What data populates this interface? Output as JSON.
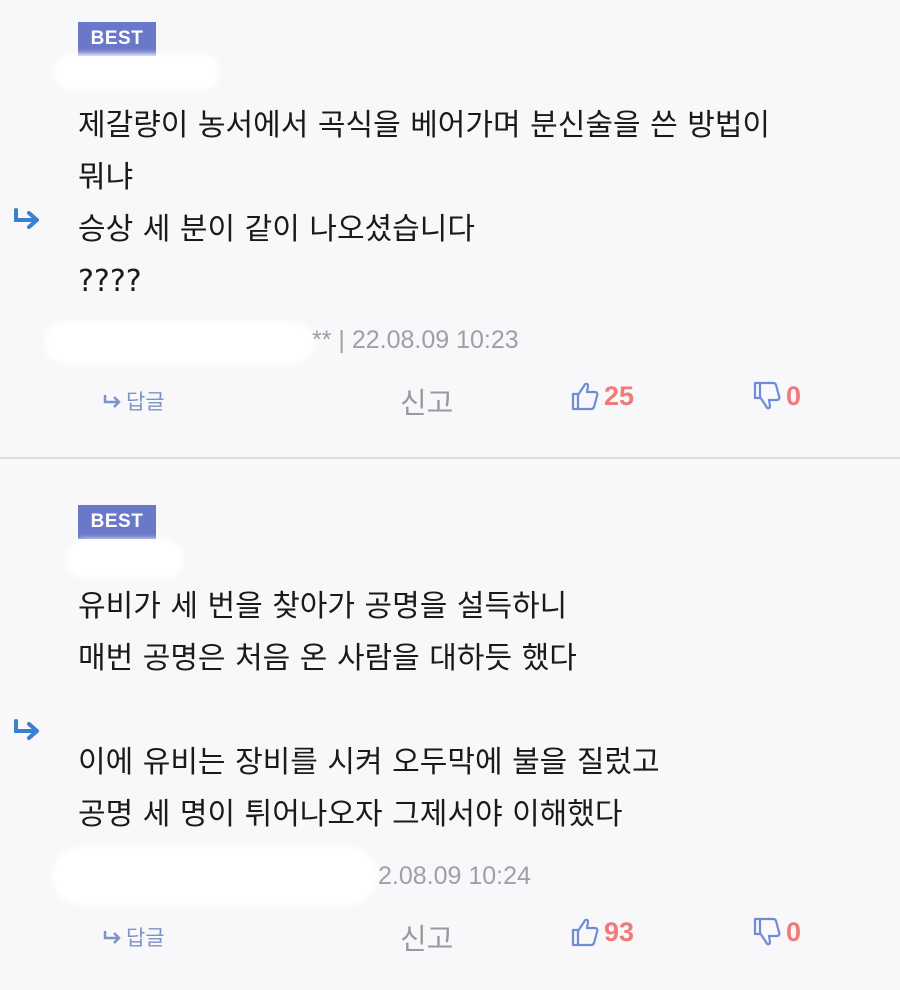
{
  "comments": [
    {
      "badge": "BEST",
      "lines": [
        "제갈량이 농서에서 곡식을 베어가며 분신술을 쓴 방법이",
        "뭐냐",
        "승상 세 분이 같이 나오셨습니다",
        "????"
      ],
      "meta": "** | 22.08.09 10:23",
      "reply_label": "답글",
      "report_label": "신고",
      "likes": "25",
      "dislikes": "0"
    },
    {
      "badge": "BEST",
      "lines": [
        "유비가 세 번을 찾아가 공명을 설득하니",
        "매번 공명은 처음 온 사람을 대하듯 했다",
        "",
        "이에 유비는 장비를 시켜 오두막에 불을 질렀고",
        "공명 세 명이 튀어나오자 그제서야 이해했다"
      ],
      "meta": "2.08.09 10:24",
      "reply_label": "답글",
      "report_label": "신고",
      "likes": "93",
      "dislikes": "0"
    }
  ],
  "colors": {
    "badge": "#6a78c9",
    "reply": "#7d93c8",
    "count": "#f07a7a",
    "like_icon": "#6f8cd6",
    "dislike_icon": "#6f8cd6",
    "arrow": "#3a7fd0"
  }
}
